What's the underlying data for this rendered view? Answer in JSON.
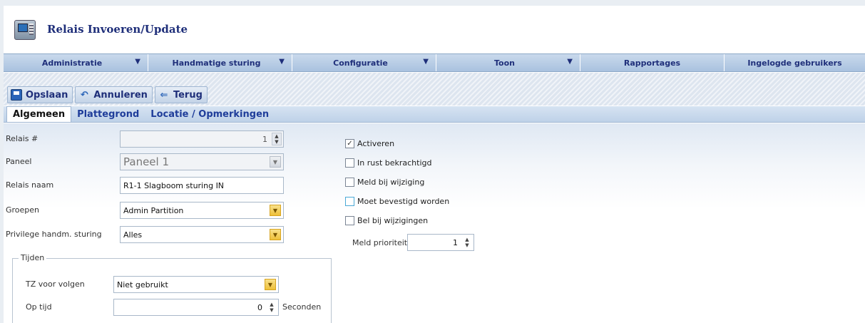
{
  "header": {
    "title": "Relais Invoeren/Update",
    "icon": "panel-icon"
  },
  "menu": [
    {
      "label": "Administratie",
      "has_dropdown": true
    },
    {
      "label": "Handmatige sturing",
      "has_dropdown": true
    },
    {
      "label": "Configuratie",
      "has_dropdown": true
    },
    {
      "label": "Toon",
      "has_dropdown": true
    },
    {
      "label": "Rapportages",
      "has_dropdown": false
    },
    {
      "label": "Ingelogde gebruikers",
      "has_dropdown": false
    }
  ],
  "toolbar": {
    "save": "Opslaan",
    "cancel": "Annuleren",
    "back": "Terug"
  },
  "tabs": [
    "Algemeen",
    "Plattegrond",
    "Locatie / Opmerkingen"
  ],
  "form": {
    "relais_nr": {
      "label": "Relais #",
      "value": "1"
    },
    "paneel": {
      "label": "Paneel",
      "value": "Paneel 1"
    },
    "relais_naam": {
      "label": "Relais naam",
      "value": "R1-1 Slagboom sturing IN"
    },
    "groepen": {
      "label": "Groepen",
      "value": "Admin Partition"
    },
    "privilege": {
      "label": "Privilege handm. sturing",
      "value": "Alles"
    }
  },
  "tijden": {
    "legend": "Tijden",
    "tz_label": "TZ voor volgen",
    "tz_value": "Niet gebruikt",
    "op_tijd_label": "Op tijd",
    "op_tijd_value": "0",
    "unit": "Seconden"
  },
  "options": {
    "activeren": {
      "label": "Activeren",
      "checked": true
    },
    "in_rust": {
      "label": "In rust bekrachtigd",
      "checked": false
    },
    "meld_wijziging": {
      "label": "Meld bij wijziging",
      "checked": false
    },
    "bevestigd": {
      "label": "Moet bevestigd worden",
      "checked": false
    },
    "bel": {
      "label": "Bel bij wijzigingen",
      "checked": false
    },
    "prioriteit_label": "Meld prioriteit",
    "prioriteit_value": "1"
  },
  "colors": {
    "title": "#1f2f7a",
    "menu_bg": "#b8cde5",
    "accent_dropdown": "#eec03a"
  }
}
